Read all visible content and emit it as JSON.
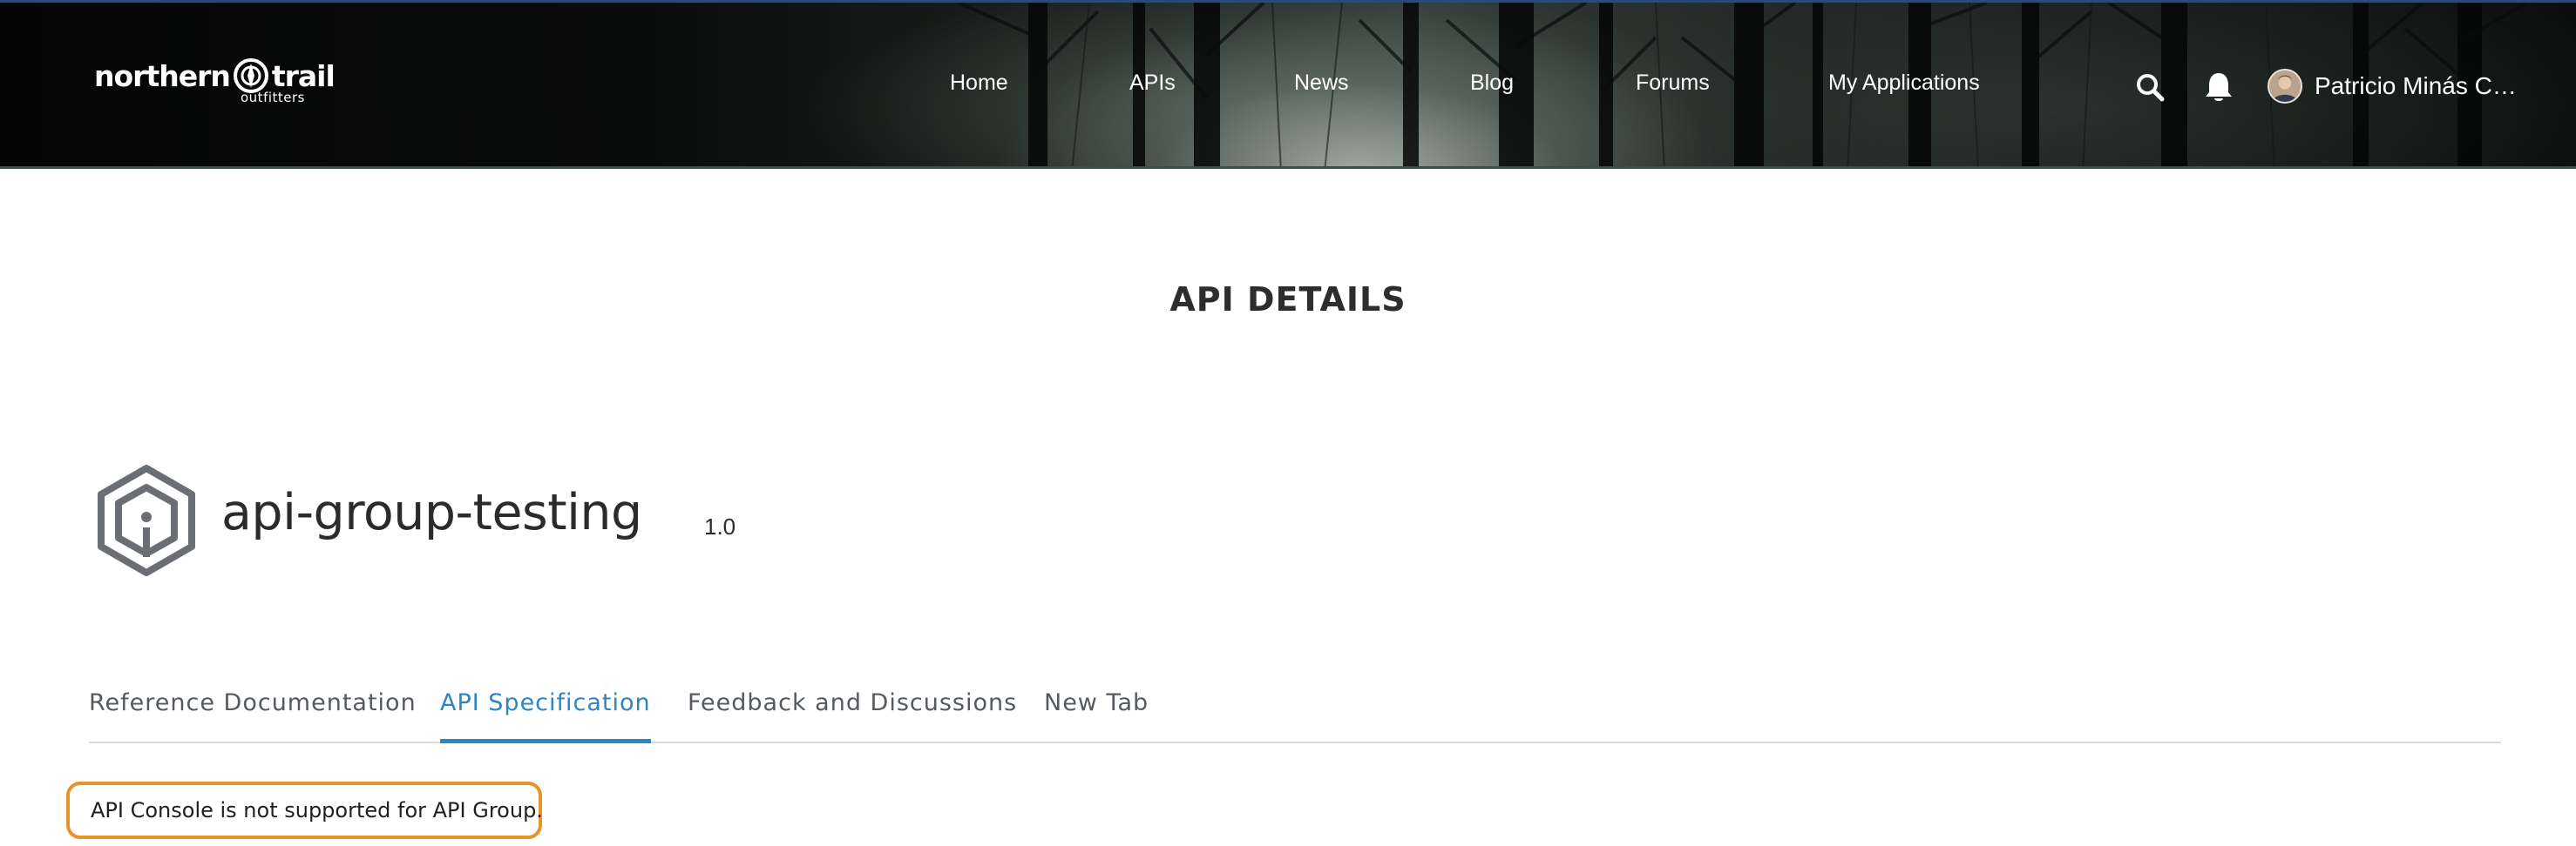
{
  "header": {
    "logo": {
      "word_left": "northern",
      "word_right": "trail",
      "sub": "outfitters"
    },
    "nav": [
      {
        "label": "Home"
      },
      {
        "label": "APIs"
      },
      {
        "label": "News"
      },
      {
        "label": "Blog"
      },
      {
        "label": "Forums"
      },
      {
        "label": "My Applications"
      }
    ],
    "icons": {
      "search": "search-icon",
      "notifications": "bell-icon"
    },
    "user": {
      "name": "Patricio Minás Ca..."
    }
  },
  "main": {
    "page_title": "API DETAILS",
    "api": {
      "name": "api-group-testing",
      "version": "1.0",
      "icon": "api-hexagon-icon"
    },
    "tabs": [
      {
        "label": "Reference Documentation",
        "active": false
      },
      {
        "label": "API Specification",
        "active": true
      },
      {
        "label": "Feedback and Discussions",
        "active": false
      },
      {
        "label": "New Tab",
        "active": false
      }
    ],
    "notice": "API Console is not supported for API Group."
  },
  "colors": {
    "accent": "#2b86c4",
    "notice_border": "#e8922a",
    "text": "#2b2b2b"
  }
}
